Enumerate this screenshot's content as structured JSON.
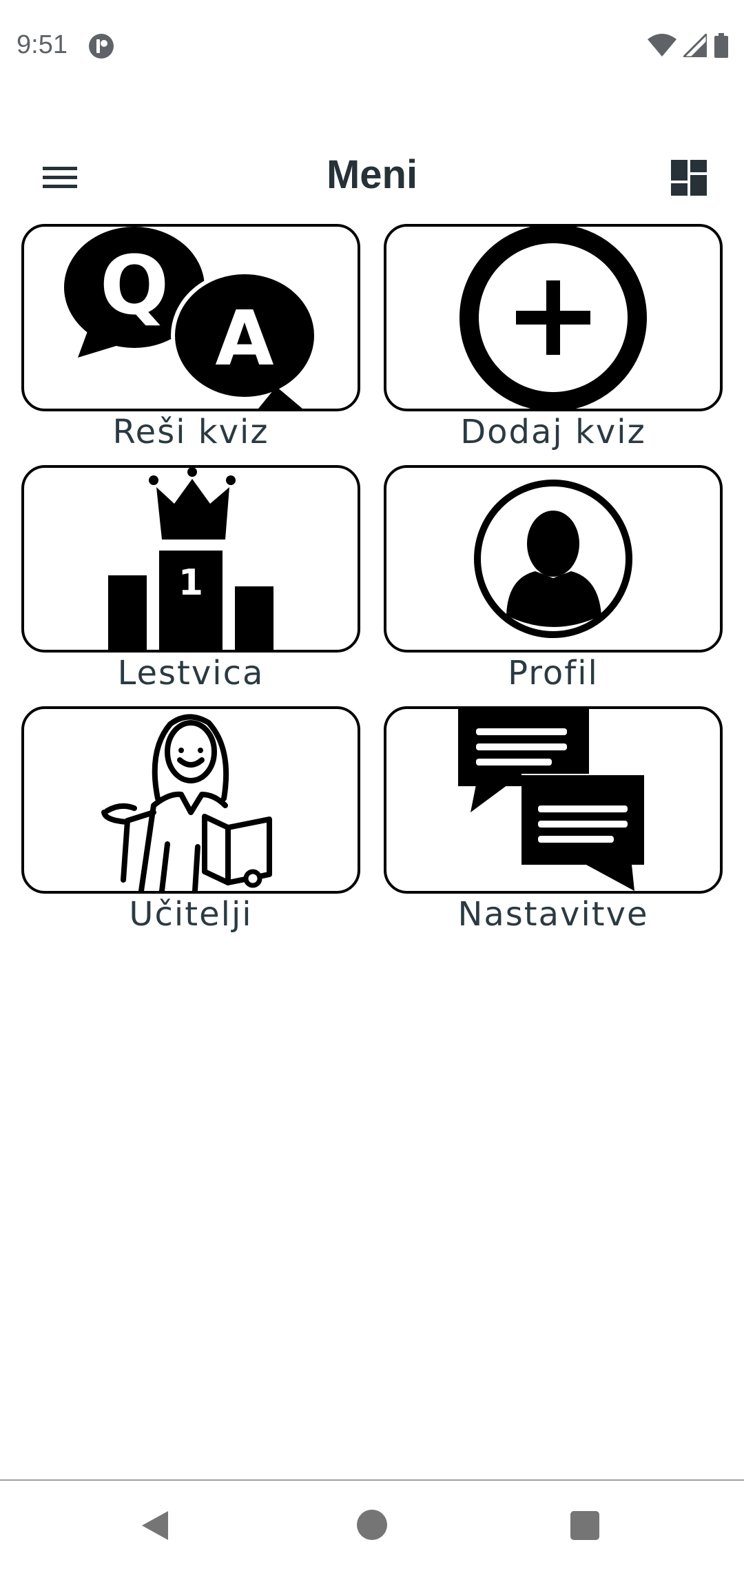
{
  "status_bar": {
    "time": "9:51"
  },
  "toolbar": {
    "title": "Meni"
  },
  "tiles": [
    {
      "label": "Reši kviz",
      "icon": "qa-bubbles-icon"
    },
    {
      "label": "Dodaj kviz",
      "icon": "plus-circle-icon"
    },
    {
      "label": "Lestvica",
      "icon": "podium-crown-icon"
    },
    {
      "label": "Profil",
      "icon": "user-circle-icon"
    },
    {
      "label": "Učitelji",
      "icon": "teacher-reading-icon"
    },
    {
      "label": "Nastavitve",
      "icon": "chat-bubbles-icon"
    }
  ],
  "icons": {
    "menu": "hamburger-icon",
    "layout": "dashboard-icon",
    "nav": [
      "back-icon",
      "home-icon",
      "recents-icon"
    ]
  },
  "colors": {
    "title": "#263238",
    "border": "#000000",
    "label": "#2b3a42"
  }
}
